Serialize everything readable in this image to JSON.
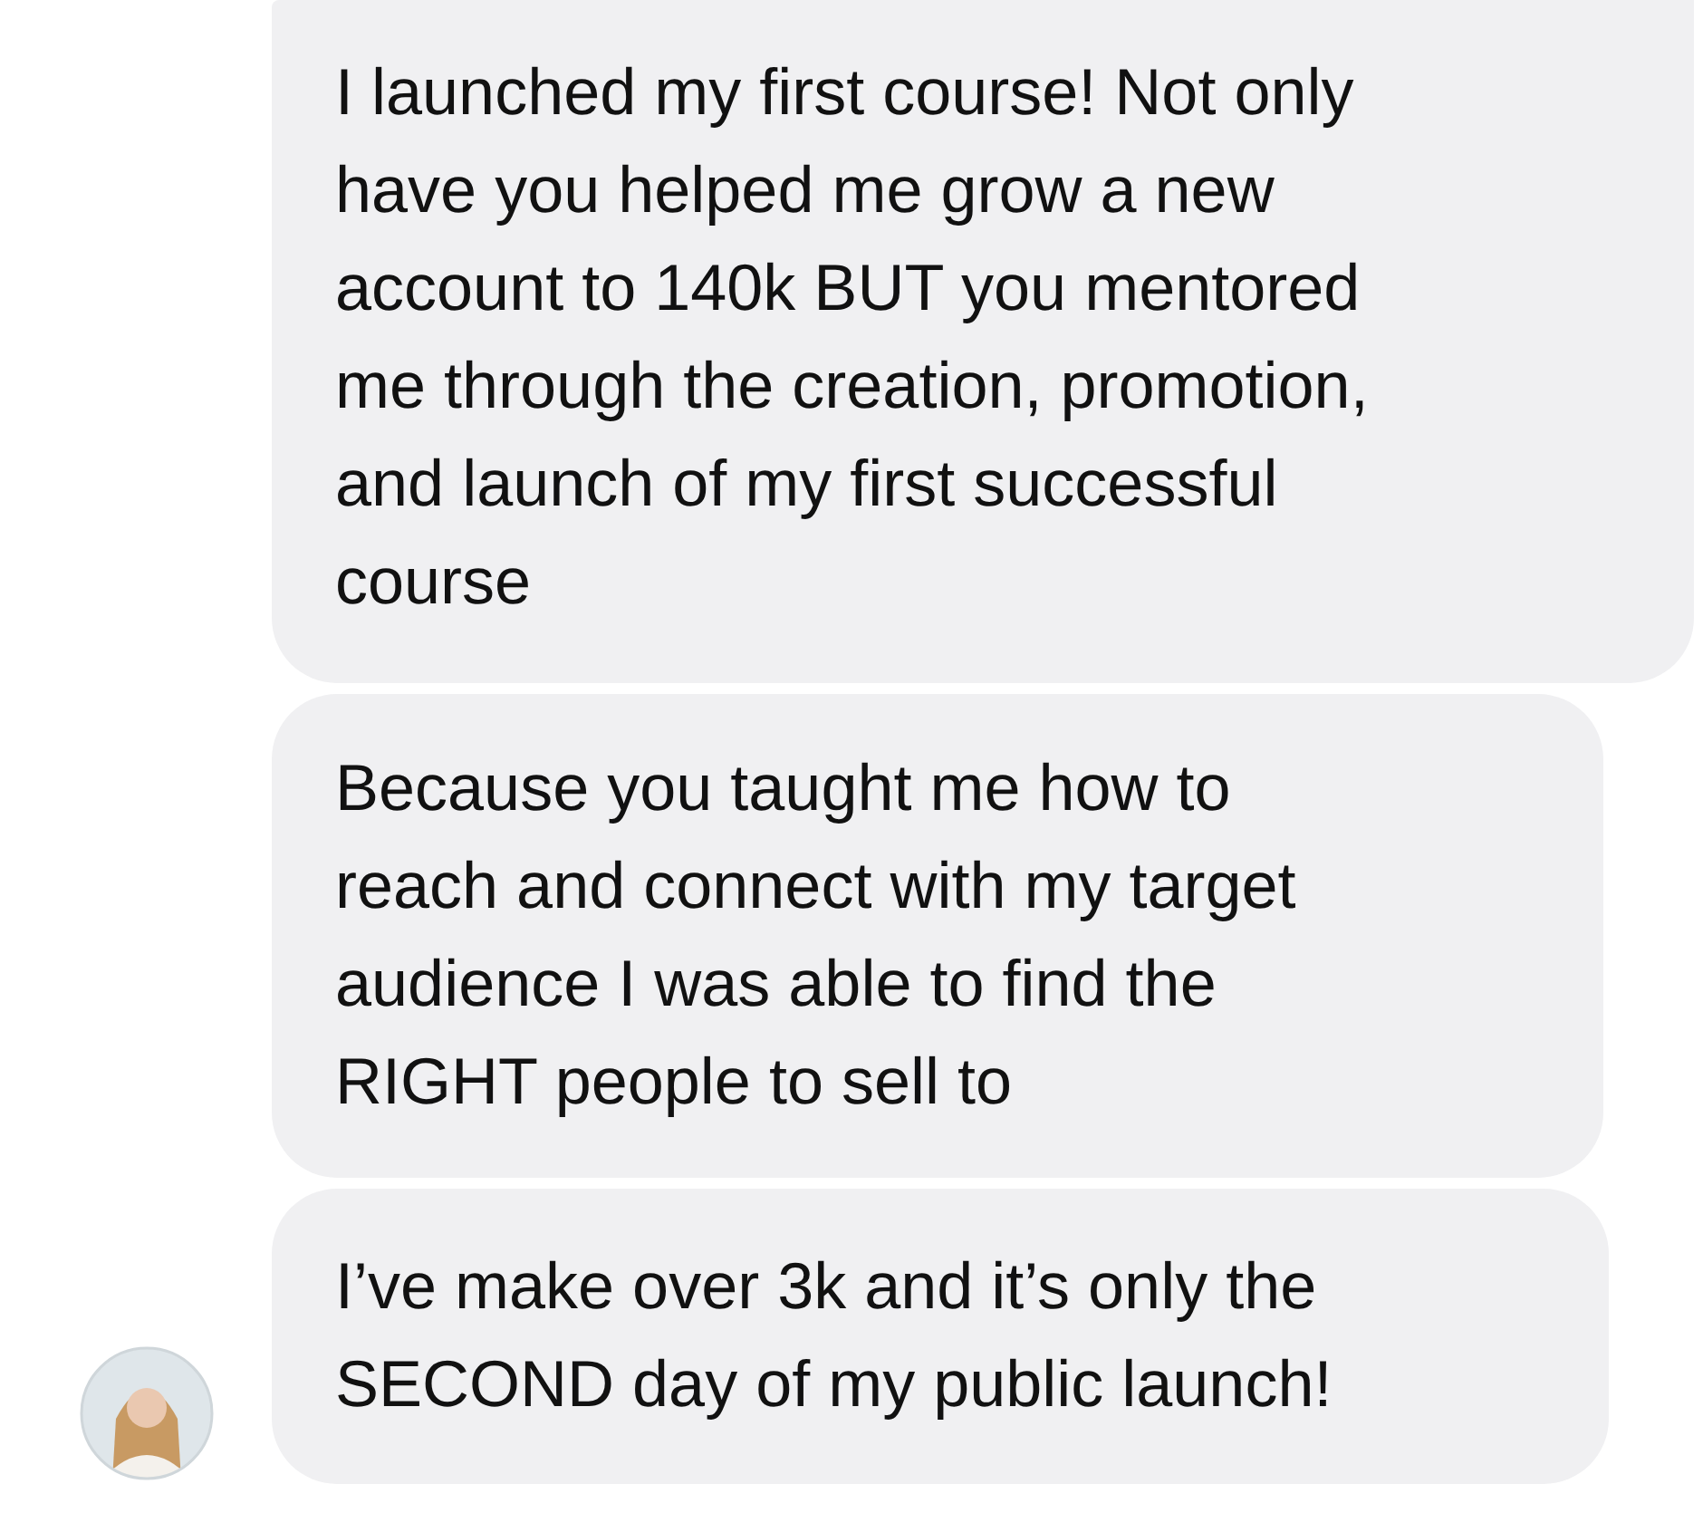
{
  "messages": [
    {
      "lines": [
        "I launched my first course! Not only",
        "have you helped me grow a new",
        "account to 140k BUT you mentored",
        "me through the creation, promotion,",
        "and launch of my first successful",
        "course"
      ],
      "avatar": false
    },
    {
      "lines": [
        "Because you taught me how to",
        "reach and connect with my target",
        "audience I was able to find the",
        "RIGHT people to sell to"
      ],
      "avatar": false
    },
    {
      "lines": [
        "I’ve make over 3k and it’s only the",
        "SECOND day of my public launch!"
      ],
      "avatar": true
    }
  ]
}
